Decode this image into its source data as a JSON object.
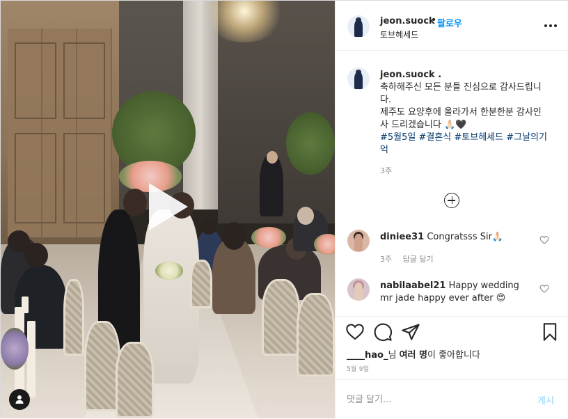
{
  "post": {
    "author": "jeon.suock",
    "separator": "•",
    "follow_label": "팔로우",
    "location": "토브헤세드",
    "caption_author": "jeon.suock .",
    "caption_line1": "축하해주신 모든 분들 진심으로 감사드립니다.",
    "caption_line2": "제주도 요양후에 올라가서 한분한분 감사인사 드리겠습니다 🙏🏻🖤",
    "hashtags": "#5월5일 #결혼식 #토브헤세드 #그날의기억",
    "caption_time": "3주"
  },
  "comments": [
    {
      "user": "diniee31",
      "text": "Congratsss Sir🙏🏻",
      "time": "3주",
      "reply_label": "답글 달기"
    },
    {
      "user": "nabilaabel21",
      "text": "Happy wedding mr jade happy ever after 😍"
    }
  ],
  "likes": {
    "liker": "____hao_",
    "suffix_1": "님",
    "others": "여러 명",
    "suffix_2": "이 좋아합니다"
  },
  "date": "5월 9일",
  "comment_box": {
    "placeholder": "댓글 달기...",
    "post_label": "게시"
  },
  "icons": {
    "more": "more-options-icon",
    "load_more": "plus-circle-icon",
    "like": "heart-icon",
    "comment": "comment-bubble-icon",
    "share": "paper-plane-icon",
    "save": "bookmark-icon",
    "tag": "user-tag-icon",
    "play": "play-icon"
  },
  "colors": {
    "link": "#0095f6",
    "hashtag": "#00376b",
    "muted": "#8e8e8e",
    "post_disabled": "#b2dffc"
  }
}
